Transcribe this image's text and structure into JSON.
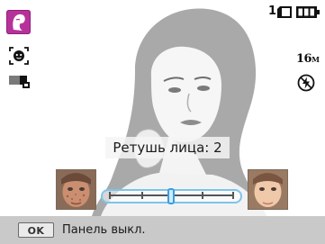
{
  "status": {
    "mode_icon": "beauty-face-mode-icon",
    "face_detect_icon": "face-detection-icon",
    "metering_icon": "metering-icon",
    "shot_count": "1",
    "memory_icon": "memory-card-icon",
    "battery_icon": "battery-full-icon",
    "resolution": "16",
    "resolution_unit": "M",
    "flash_icon": "flash-off-icon"
  },
  "face_retouch": {
    "caption": "Ретушь лица: 2",
    "level": 2,
    "levels": [
      0,
      1,
      2,
      3,
      4
    ],
    "accent_color": "#3a9ee0"
  },
  "bottom_bar": {
    "ok_label": "OK",
    "action_label": "Панель выкл."
  },
  "colors": {
    "mode_tile": "#b6329a",
    "bar_background": "#c9c9c9",
    "slider_border": "#7cc4ec"
  }
}
